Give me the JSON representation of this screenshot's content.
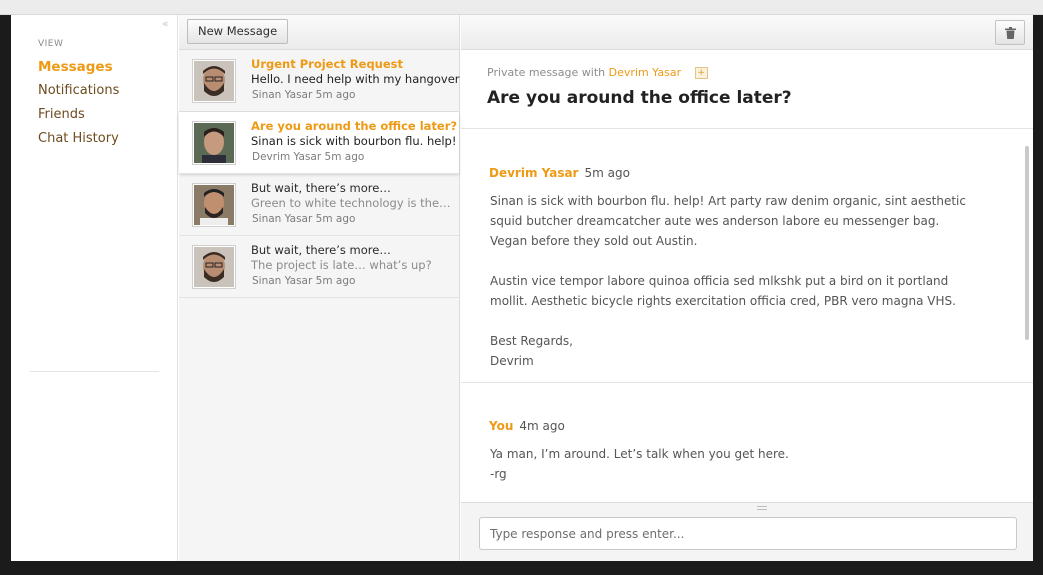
{
  "nav": {
    "collapse_glyph": "«",
    "view_label": "VIEW",
    "items": [
      {
        "label": "Messages",
        "active": true
      },
      {
        "label": "Notifications",
        "active": false
      },
      {
        "label": "Friends",
        "active": false
      },
      {
        "label": "Chat History",
        "active": false
      }
    ]
  },
  "toolbar": {
    "new_message_label": "New Message",
    "trash_icon": "trash-icon"
  },
  "messages": [
    {
      "subject": "Urgent Project Request",
      "preview": "Hello. I need help with my hangover",
      "sender": "Sinan Yasar",
      "time": "5m ago",
      "unread": true,
      "selected": false
    },
    {
      "subject": "Are you around the office later?",
      "preview": "Sinan is sick with bourbon flu. help!",
      "sender": "Devrim Yasar",
      "time": "5m ago",
      "unread": true,
      "selected": true
    },
    {
      "subject": "But wait, there’s more…",
      "preview": "Green to white technology is the…",
      "sender": "Sinan Yasar",
      "time": "5m ago",
      "unread": false,
      "selected": false
    },
    {
      "subject": "But wait, there’s more…",
      "preview": "The project is late… what’s up?",
      "sender": "Sinan Yasar",
      "time": "5m ago",
      "unread": false,
      "selected": false
    }
  ],
  "thread": {
    "private_label": "Private message with",
    "participant": "Devrim Yasar",
    "plus_label": "+",
    "title": "Are you around the office later?",
    "posts": [
      {
        "author": "Devrim Yasar",
        "time": "5m ago",
        "paragraphs": [
          "Sinan is sick with bourbon flu. help! Art party raw denim organic, sint aesthetic squid butcher dreamcatcher aute wes anderson labore eu messenger bag. Vegan before they sold out Austin.",
          "Austin vice tempor labore quinoa officia sed mlkshk put a bird on it portland mollit. Aesthetic bicycle rights exercitation officia cred, PBR vero magna VHS."
        ],
        "signoff": "Best Regards,",
        "signature": "Devrim"
      },
      {
        "author": "You",
        "time": "4m ago",
        "line1": "Ya man, I’m around. Let’s talk when you get here.",
        "line2": "-rg"
      }
    ]
  },
  "compose": {
    "placeholder": "Type response and press enter..."
  },
  "colors": {
    "accent": "#ee9a14",
    "nav_text": "#6d4c1f"
  }
}
